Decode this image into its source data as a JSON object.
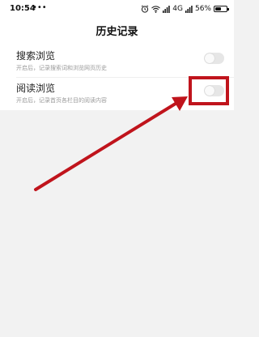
{
  "status_bar": {
    "time": "10:54",
    "dots": "•••",
    "network": "4G",
    "battery_text": "56%",
    "battery_level": 0.56,
    "icons": [
      "alarm-icon",
      "wifi-icon",
      "signal-icon",
      "battery-icon"
    ]
  },
  "header": {
    "title": "历史记录"
  },
  "settings": {
    "items": [
      {
        "label": "搜索浏览",
        "description": "开启后，记录搜索词和浏览网页历史",
        "enabled": false
      },
      {
        "label": "阅读浏览",
        "description": "开启后，记录首页各栏目的阅读内容",
        "enabled": false
      }
    ]
  },
  "annotation": {
    "color": "#c0141c"
  }
}
